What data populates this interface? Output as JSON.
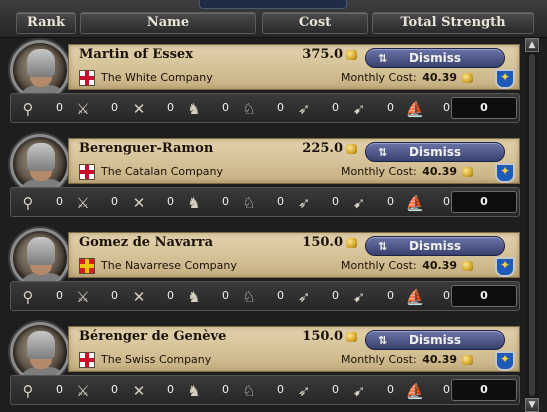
{
  "header": {
    "columns": [
      "Rank",
      "Name",
      "Cost",
      "Total Strength"
    ]
  },
  "unit_icons": [
    "militia-icon",
    "infantry-icon",
    "pikemen-icon",
    "light-cavalry-icon",
    "heavy-cavalry-icon",
    "archers-icon",
    "horse-archers-icon",
    "ship-icon"
  ],
  "dismiss_label": "Dismiss",
  "monthly_cost_label": "Monthly Cost:",
  "mercenaries": [
    {
      "name": "Martin of Essex",
      "cost": "375.0",
      "company": "The White Company",
      "monthly_cost": "40.39",
      "flag_colors": [
        "#ffffff",
        "#c8102e"
      ],
      "units": [
        "0",
        "0",
        "0",
        "0",
        "0",
        "0",
        "0",
        "0"
      ],
      "total": "0"
    },
    {
      "name": "Berenguer-Ramon",
      "cost": "225.0",
      "company": "The Catalan Company",
      "monthly_cost": "40.39",
      "flag_colors": [
        "#ffffff",
        "#c8102e"
      ],
      "units": [
        "0",
        "0",
        "0",
        "0",
        "0",
        "0",
        "0",
        "0"
      ],
      "total": "0"
    },
    {
      "name": "Gomez de Navarra",
      "cost": "150.0",
      "company": "The Navarrese Company",
      "monthly_cost": "40.39",
      "flag_colors": [
        "#d51f1f",
        "#f1c40f"
      ],
      "units": [
        "0",
        "0",
        "0",
        "0",
        "0",
        "0",
        "0",
        "0"
      ],
      "total": "0"
    },
    {
      "name": "Bérenger de Genève",
      "cost": "150.0",
      "company": "The Swiss Company",
      "monthly_cost": "40.39",
      "flag_colors": [
        "#ffffff",
        "#c8102e"
      ],
      "units": [
        "0",
        "0",
        "0",
        "0",
        "0",
        "0",
        "0",
        "0"
      ],
      "total": "0"
    }
  ]
}
